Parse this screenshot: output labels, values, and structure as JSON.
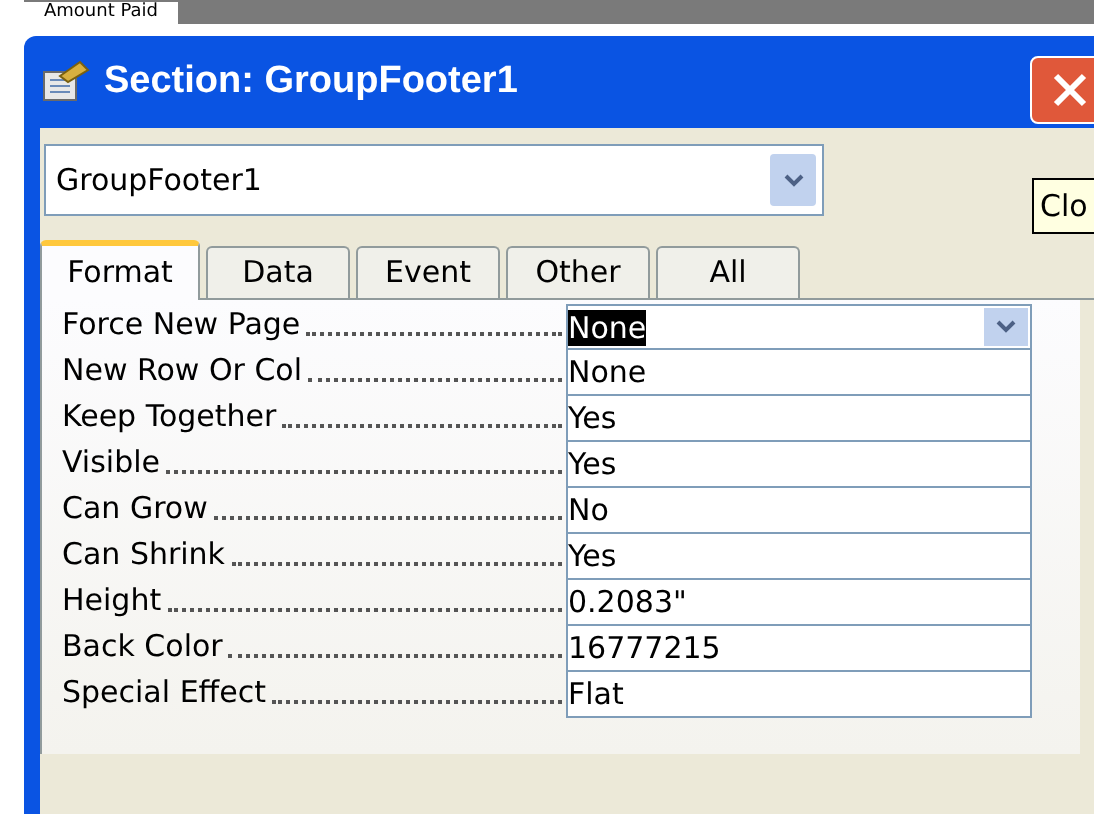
{
  "background_strip": {
    "text": "Amount Paid"
  },
  "window": {
    "title": "Section: GroupFooter1"
  },
  "object_select": {
    "value": "GroupFooter1"
  },
  "tooltip": {
    "text": "Clo"
  },
  "tabs": [
    {
      "label": "Format",
      "selected": true
    },
    {
      "label": "Data",
      "selected": false
    },
    {
      "label": "Event",
      "selected": false
    },
    {
      "label": "Other",
      "selected": false
    },
    {
      "label": "All",
      "selected": false
    }
  ],
  "properties": [
    {
      "label": "Force New Page",
      "value": "None",
      "selected": true
    },
    {
      "label": "New Row Or Col",
      "value": "None",
      "selected": false
    },
    {
      "label": "Keep Together",
      "value": "Yes",
      "selected": false
    },
    {
      "label": "Visible",
      "value": "Yes",
      "selected": false
    },
    {
      "label": "Can Grow",
      "value": "No",
      "selected": false
    },
    {
      "label": "Can Shrink",
      "value": "Yes",
      "selected": false
    },
    {
      "label": "Height",
      "value": "0.2083\"",
      "selected": false
    },
    {
      "label": "Back Color",
      "value": "16777215",
      "selected": false
    },
    {
      "label": "Special Effect",
      "value": "Flat",
      "selected": false
    }
  ]
}
